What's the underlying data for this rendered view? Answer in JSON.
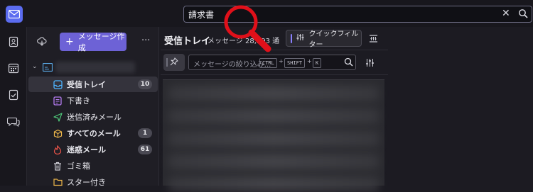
{
  "search": {
    "value": "請求書",
    "clear_icon": "close-icon",
    "search_icon": "search-icon"
  },
  "folder_pane": {
    "new_message_label": "メッセージ作成",
    "more_label": "···",
    "folders": [
      {
        "label": "受信トレイ",
        "icon": "inbox-icon",
        "badge": "10",
        "selected": true,
        "bold": true
      },
      {
        "label": "下書き",
        "icon": "draft-icon",
        "badge": "",
        "selected": false,
        "bold": false
      },
      {
        "label": "送信済みメール",
        "icon": "sent-icon",
        "badge": "",
        "selected": false,
        "bold": false
      },
      {
        "label": "すべてのメール",
        "icon": "archive-box-icon",
        "badge": "1",
        "selected": false,
        "bold": true
      },
      {
        "label": "迷惑メール",
        "icon": "spam-flame-icon",
        "badge": "61",
        "selected": false,
        "bold": true
      },
      {
        "label": "ゴミ箱",
        "icon": "trash-icon",
        "badge": "",
        "selected": false,
        "bold": false
      },
      {
        "label": "スター付き",
        "icon": "folder-icon",
        "badge": "",
        "selected": false,
        "bold": false
      }
    ]
  },
  "message_list": {
    "title": "受信トレイ",
    "count_text": "メッセージ 28,593 通",
    "quick_filter_label": "クイックフィルター",
    "filter_placeholder": "メッセージの絞り込み...",
    "shortcut_keys": [
      "CTRL",
      "SHIFT",
      "K"
    ]
  },
  "colors": {
    "accent": "#6d62d6",
    "logo": "#5b6cf0",
    "annotation": "#e0101a"
  }
}
